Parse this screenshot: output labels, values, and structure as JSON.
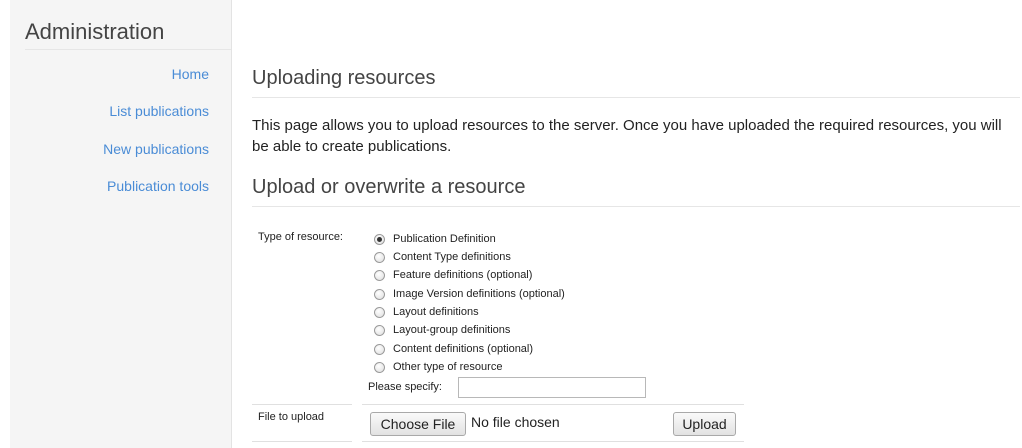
{
  "sidebar": {
    "title": "Administration",
    "items": [
      {
        "label": "Home"
      },
      {
        "label": "List publications"
      },
      {
        "label": "New publications"
      },
      {
        "label": "Publication tools"
      }
    ]
  },
  "main": {
    "heading": "Uploading resources",
    "intro": "This page allows you to upload resources to the server. Once you have uploaded the required resources, you will be able to create publications.",
    "form_heading": "Upload or overwrite a resource",
    "type_label": "Type of resource:",
    "resource_types": [
      {
        "label": "Publication Definition",
        "checked": true
      },
      {
        "label": "Content Type definitions",
        "checked": false
      },
      {
        "label": "Feature definitions (optional)",
        "checked": false
      },
      {
        "label": "Image Version definitions (optional)",
        "checked": false
      },
      {
        "label": "Layout definitions",
        "checked": false
      },
      {
        "label": "Layout-group definitions",
        "checked": false
      },
      {
        "label": "Content definitions (optional)",
        "checked": false
      },
      {
        "label": "Other type of resource",
        "checked": false
      }
    ],
    "specify_label": "Please specify:",
    "specify_value": "",
    "file_label": "File to upload",
    "choose_file_label": "Choose File",
    "no_file_text": "No file chosen",
    "upload_label": "Upload"
  },
  "colors": {
    "link": "#4a8cd6",
    "sidebar_bg": "#f5f5f5"
  }
}
